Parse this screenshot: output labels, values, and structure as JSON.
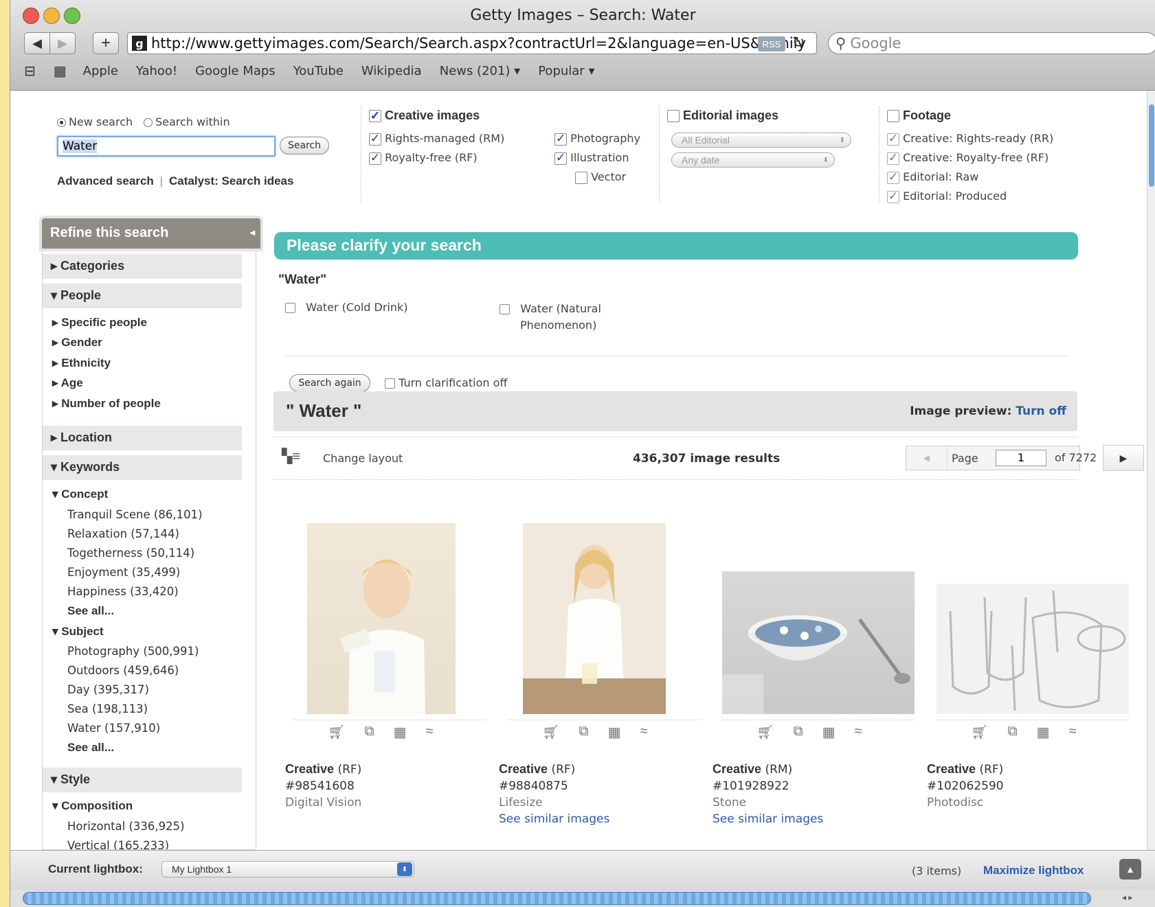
{
  "window": {
    "title": "Getty Images – Search: Water"
  },
  "toolbar": {
    "url": "http://www.gettyimages.com/Search/Search.aspx?contractUrl=2&language=en-US&family",
    "rss": "RSS",
    "search_placeholder": "Google"
  },
  "bookmarks": [
    "Apple",
    "Yahoo!",
    "Google Maps",
    "YouTube",
    "Wikipedia",
    "News (201)",
    "Popular"
  ],
  "search": {
    "new_search": "New search",
    "search_within": "Search within",
    "query": "Water",
    "button": "Search",
    "advanced": "Advanced search",
    "catalyst": "Catalyst: Search ideas"
  },
  "filters": {
    "creative": {
      "label": "Creative images",
      "rm": "Rights-managed (RM)",
      "rf": "Royalty-free (RF)",
      "photography": "Photography",
      "illustration": "Illustration",
      "vector": "Vector"
    },
    "editorial": {
      "label": "Editorial images",
      "collection": "All Editorial",
      "date": "Any date"
    },
    "footage": {
      "label": "Footage",
      "items": [
        "Creative: Rights-ready (RR)",
        "Creative: Royalty-free (RF)",
        "Editorial: Raw",
        "Editorial: Produced"
      ]
    }
  },
  "sidebar": {
    "title": "Refine this search",
    "categories": "Categories",
    "people": "People",
    "people_items": [
      "Specific people",
      "Gender",
      "Ethnicity",
      "Age",
      "Number of people"
    ],
    "location": "Location",
    "keywords": "Keywords",
    "concept": "Concept",
    "concept_items": [
      "Tranquil Scene (86,101)",
      "Relaxation (57,144)",
      "Togetherness (50,114)",
      "Enjoyment (35,499)",
      "Happiness (33,420)"
    ],
    "see_all": "See all...",
    "subject": "Subject",
    "subject_items": [
      "Photography (500,991)",
      "Outdoors (459,646)",
      "Day (395,317)",
      "Sea (198,113)",
      "Water (157,910)"
    ],
    "style": "Style",
    "composition": "Composition",
    "composition_items": [
      "Horizontal (336,925)",
      "Vertical (165,233)"
    ]
  },
  "clarify": {
    "title": "Please clarify your search",
    "term": "\"Water\"",
    "option1": "Water (Cold Drink)",
    "option2_line1": "Water (Natural",
    "option2_line2": "Phenomenon)",
    "search_again": "Search again",
    "turn_off": "Turn clarification off"
  },
  "results": {
    "heading": "\" Water \"",
    "preview_label": "Image preview:",
    "preview_link": "Turn off",
    "change_layout": "Change layout",
    "count": "436,307 image results",
    "page_label": "Page",
    "page": "1",
    "of_pages": "of 7272",
    "images": [
      {
        "type": "Creative",
        "license": "(RF)",
        "id": "#98541608",
        "source": "Digital Vision",
        "similar": ""
      },
      {
        "type": "Creative",
        "license": "(RF)",
        "id": "#98840875",
        "source": "Lifesize",
        "similar": "See similar images"
      },
      {
        "type": "Creative",
        "license": "(RM)",
        "id": "#101928922",
        "source": "Stone",
        "similar": "See similar images"
      },
      {
        "type": "Creative",
        "license": "(RF)",
        "id": "#102062590",
        "source": "Photodisc",
        "similar": ""
      }
    ]
  },
  "lightbox": {
    "label": "Current lightbox:",
    "selected": "My Lightbox 1",
    "items": "(3 items)",
    "maximize": "Maximize lightbox"
  },
  "colors": {
    "clarify_bar": "#4dbdb5",
    "link": "#2d5aa8",
    "refine_header": "#8e8a84"
  }
}
